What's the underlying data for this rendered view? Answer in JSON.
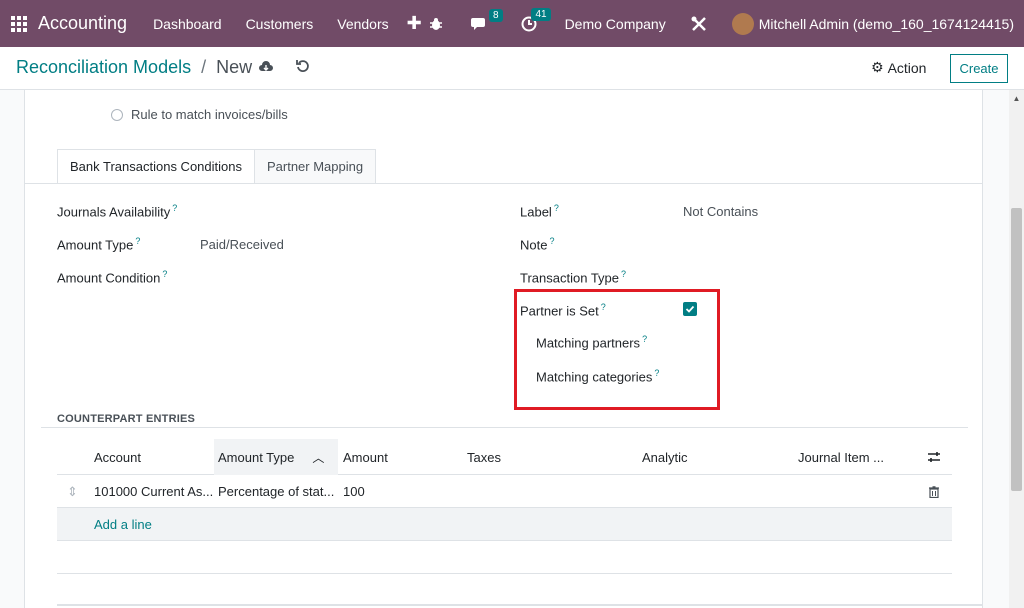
{
  "navbar": {
    "app_name": "Accounting",
    "menu": [
      "Dashboard",
      "Customers",
      "Vendors"
    ],
    "messages_count": "8",
    "activities_count": "41",
    "company": "Demo Company",
    "user": "Mitchell Admin (demo_160_1674124415)"
  },
  "control_panel": {
    "breadcrumb_parent": "Reconciliation Models",
    "breadcrumb_separator": "/",
    "breadcrumb_current": "New",
    "action_label": "Action",
    "create_label": "Create"
  },
  "form": {
    "radio_option": "Rule to match invoices/bills",
    "tabs": [
      "Bank Transactions Conditions",
      "Partner Mapping"
    ],
    "left_fields": {
      "journals_availability": "Journals Availability",
      "amount_type": "Amount Type",
      "amount_type_value": "Paid/Received",
      "amount_condition": "Amount Condition"
    },
    "right_fields": {
      "label": "Label",
      "label_value": "Not Contains",
      "note": "Note",
      "transaction_type": "Transaction Type",
      "partner_is_set": "Partner is Set",
      "partner_is_set_checked": true,
      "matching_partners": "Matching partners",
      "matching_categories": "Matching categories"
    },
    "help_mark": "?"
  },
  "counterpart": {
    "title": "COUNTERPART ENTRIES",
    "columns": [
      "Account",
      "Amount Type",
      "Amount",
      "Taxes",
      "Analytic",
      "Journal Item ..."
    ],
    "rows": [
      {
        "account": "101000 Current As...",
        "amount_type": "Percentage of stat...",
        "amount": "100"
      }
    ],
    "add_line": "Add a line"
  },
  "colors": {
    "navbar": "#714b67",
    "accent": "#017e84",
    "highlight": "#e01b24"
  }
}
